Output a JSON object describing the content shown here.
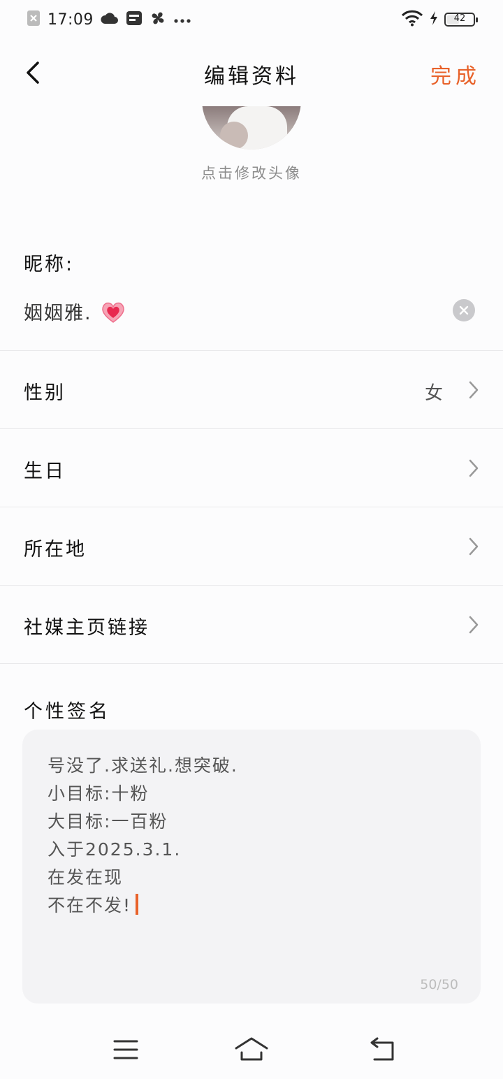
{
  "status_bar": {
    "time": "17:09",
    "battery": "42",
    "battery_level": 0.42,
    "icons": [
      "close-box-icon",
      "cloud-icon",
      "sim-card-icon",
      "fan-icon",
      "more-dots-icon",
      "wifi-icon",
      "charging-bolt-icon",
      "battery-icon"
    ]
  },
  "header": {
    "back_icon": "chevron-left-icon",
    "title": "编辑资料",
    "done_label": "完成"
  },
  "avatar": {
    "hint": "点击修改头像"
  },
  "nickname": {
    "label": "昵称:",
    "value": "姻姻雅.",
    "emoji_icon": "sparkling-heart-icon",
    "clear_icon": "clear-circle-icon"
  },
  "rows": [
    {
      "label": "性别",
      "value": "女"
    },
    {
      "label": "生日",
      "value": ""
    },
    {
      "label": "所在地",
      "value": ""
    },
    {
      "label": "社媒主页链接",
      "value": ""
    }
  ],
  "signature": {
    "label": "个性签名",
    "text": "号没了.求送礼.想突破.\n小目标:十粉\n大目标:一百粉\n入于2025.3.1.\n在发在现\n不在不发!",
    "count": "50/50"
  },
  "nav": {
    "icons": [
      "menu-icon",
      "home-icon",
      "back-arrow-icon"
    ]
  },
  "colors": {
    "accent": "#e8622a",
    "background": "#fcfcfd",
    "text": "#111111",
    "muted": "#8c8c8c",
    "divider": "#e9e9eb",
    "signature_bg": "#f3f3f5"
  }
}
